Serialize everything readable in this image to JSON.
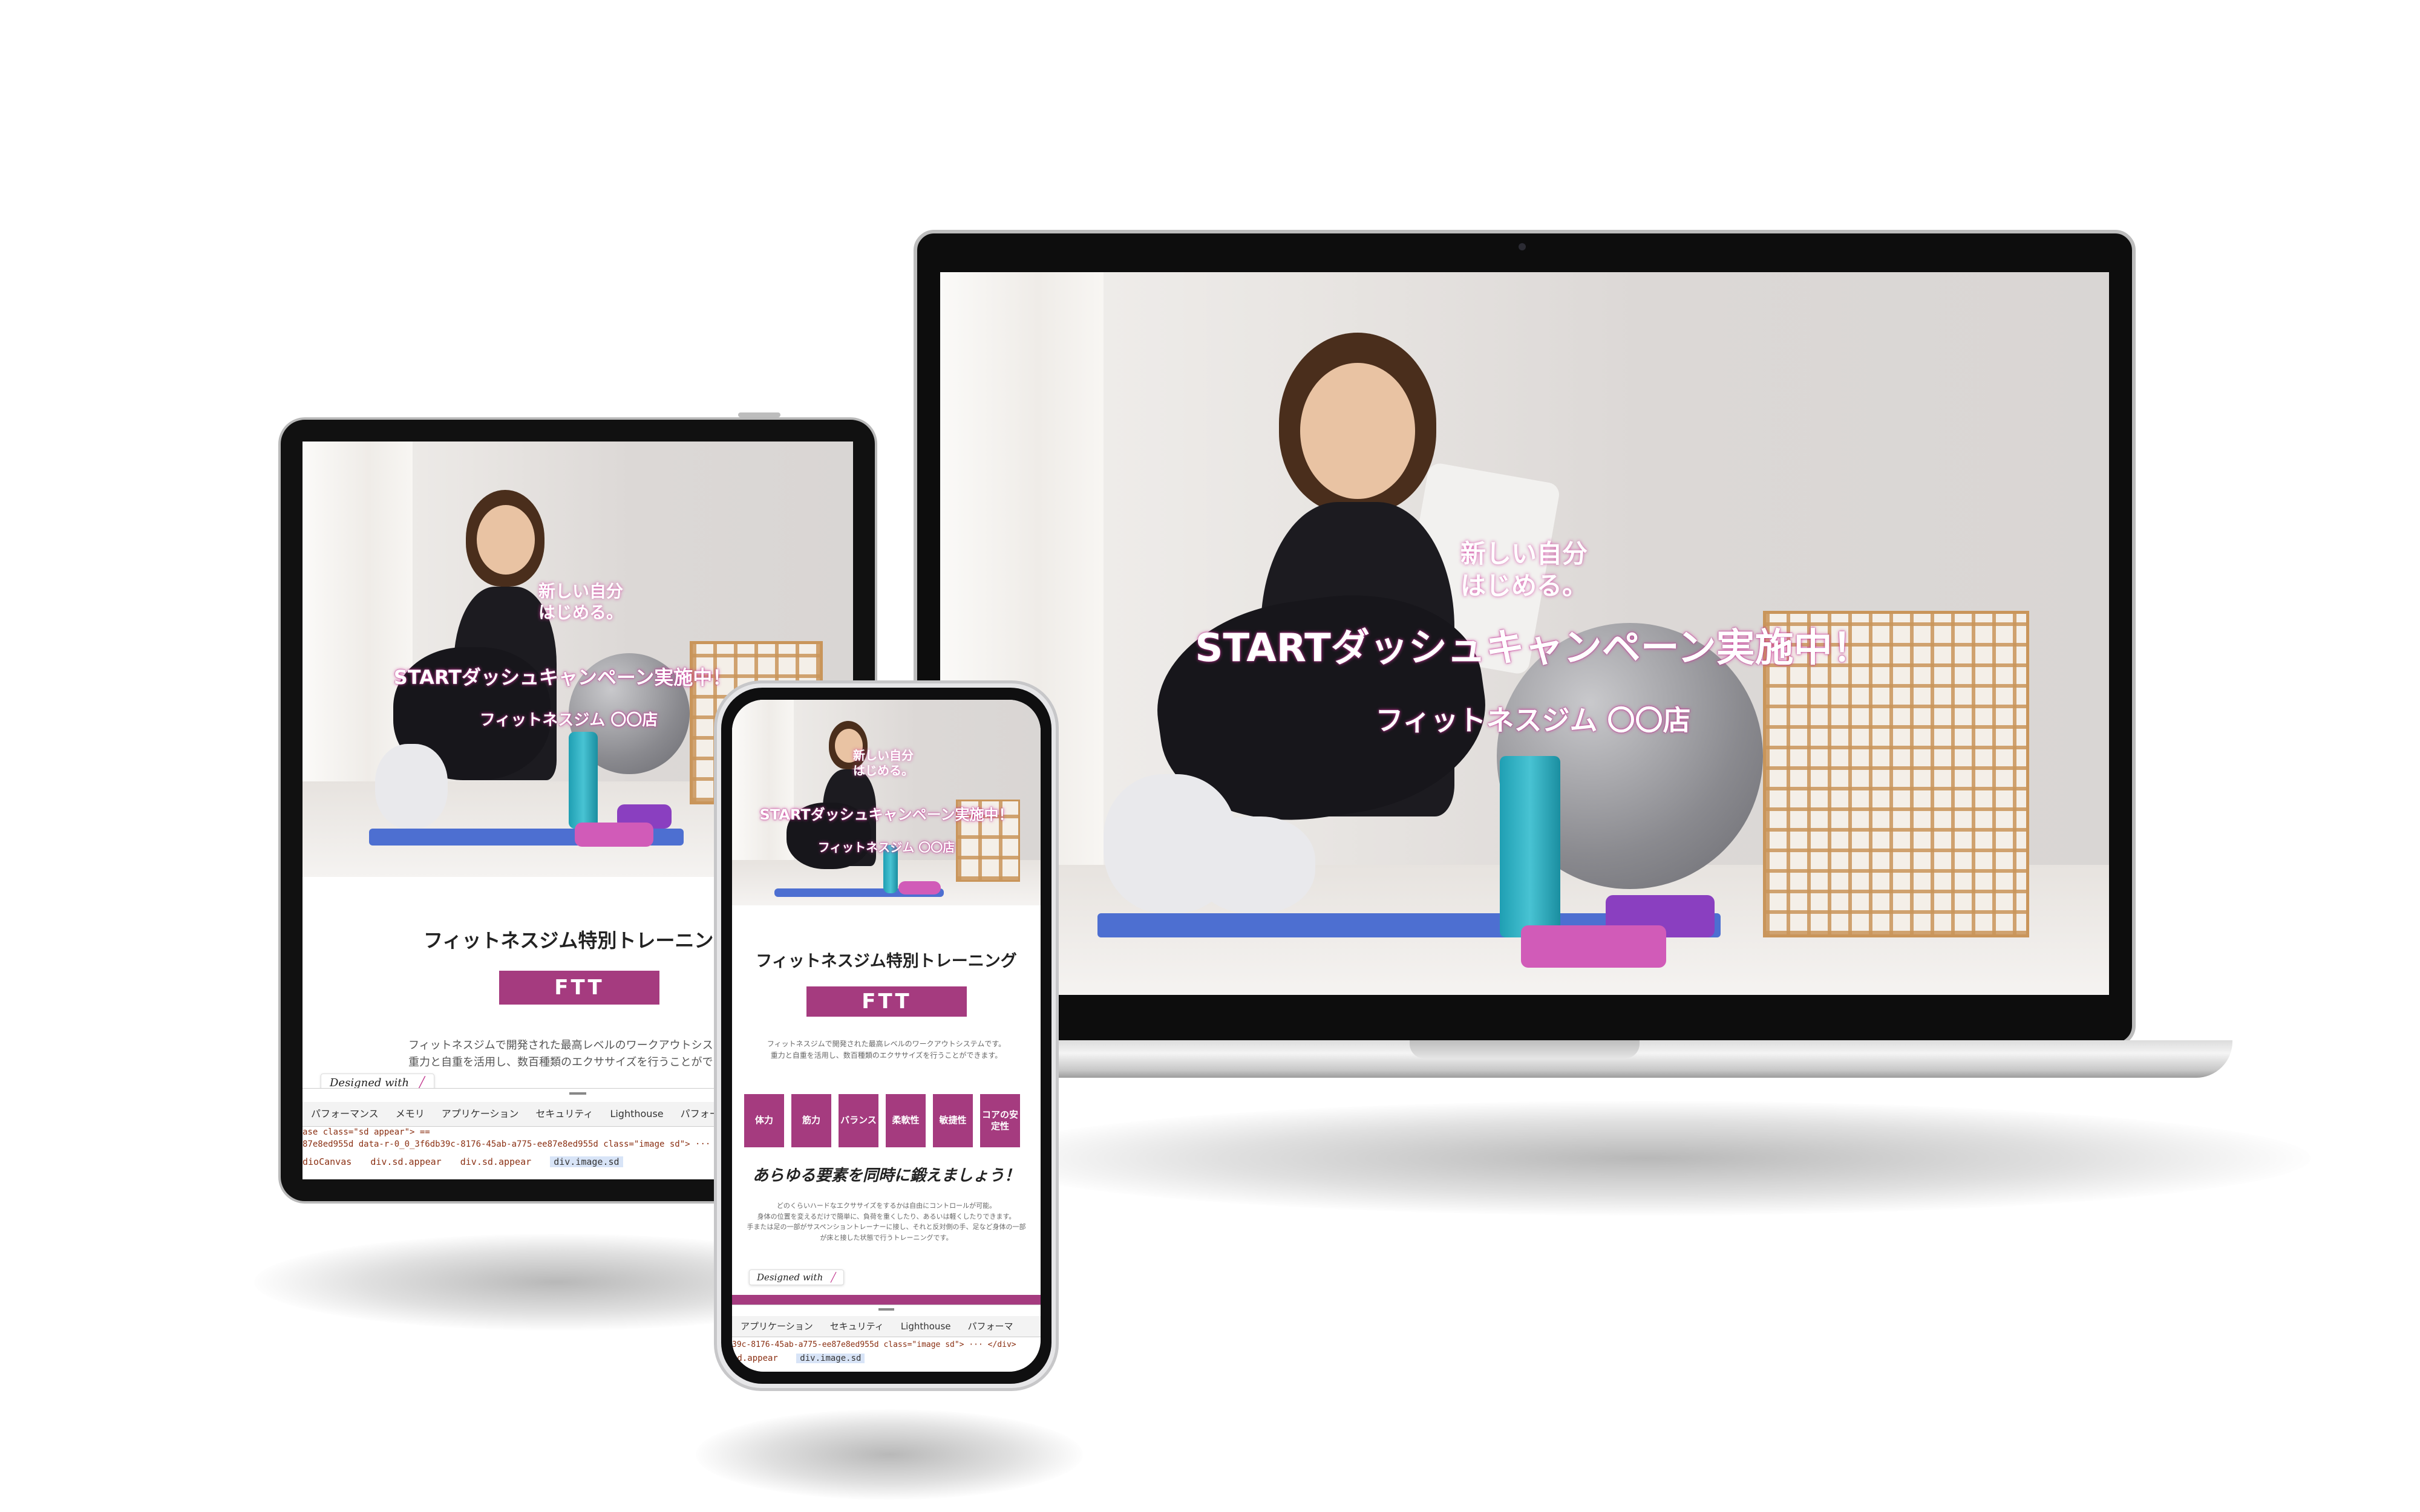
{
  "laptop": {
    "hero": {
      "tagline_line1": "新しい自分",
      "tagline_line2": "はじめる。",
      "campaign": "STARTダッシュキャンペーン実施中！",
      "gym_name": "フィットネスジム 〇〇店"
    }
  },
  "tablet": {
    "hero": {
      "tagline_line1": "新しい自分",
      "tagline_line2": "はじめる。",
      "campaign": "STARTダッシュキャンペーン実施中！",
      "gym_name": "フィットネスジム 〇〇店"
    },
    "section_title": "フィットネスジム特別トレーニン",
    "ftt_label": "FTT",
    "description_line1": "フィットネスジムで開発された最高レベルのワークアウトシステ",
    "description_line2": "重力と自重を活用し、数百種類のエクササイズを行うことができ",
    "designed_with": "Designed with",
    "devtools": {
      "tabs": [
        "パフォーマンス",
        "メモリ",
        "アプリケーション",
        "セキュリティ",
        "Lighthouse",
        "パフォーマ"
      ],
      "line1": "ase class=\"sd appear\"> ==",
      "line2": "87e8ed955d data-r-0_0_3f6db39c-8176-45ab-a775-ee87e8ed955d class=\"image sd\"> ··· </div>",
      "crumbs": [
        "dioCanvas",
        "div.sd.appear",
        "div.sd.appear",
        "div.image.sd"
      ]
    }
  },
  "phone": {
    "hero": {
      "tagline_line1": "新しい自分",
      "tagline_line2": "はじめる。",
      "campaign": "STARTダッシュキャンペーン実施中！",
      "gym_name": "フィットネスジム 〇〇店"
    },
    "section_title": "フィットネスジム特別トレーニング",
    "ftt_label": "FTT",
    "description_line1": "フィットネスジムで開発された最高レベルのワークアウトシステムです。",
    "description_line2": "重力と自重を活用し、数百種類のエクササイズを行うことができます。",
    "features": [
      "体力",
      "筋力",
      "バランス",
      "柔軟性",
      "敏捷性",
      "コアの安定性"
    ],
    "tagline": "あらゆる要素を同時に鍛えましょう！",
    "body_line1": "どのくらいハードなエクササイズをするかは自由にコントロールが可能。",
    "body_line2": "身体の位置を変えるだけで簡単に、負荷を重くしたり、あるいは軽くしたりできます。",
    "body_line3": "手または足の一部がサスペンショントレーナーに接し、それと反対側の手、足など身体の一部",
    "body_line4": "が床と接した状態で行うトレーニングです。",
    "designed_with": "Designed with",
    "devtools": {
      "tabs": [
        "アプリケーション",
        "セキュリティ",
        "Lighthouse",
        "パフォーマ"
      ],
      "line1": "39c-8176-45ab-a775-ee87e8ed955d class=\"image sd\"> ··· </div>",
      "crumbs": [
        "sd.appear",
        "div.image.sd"
      ]
    }
  },
  "colors": {
    "accent": "#a53b7f",
    "overlay_glow": "#d23ca0"
  }
}
